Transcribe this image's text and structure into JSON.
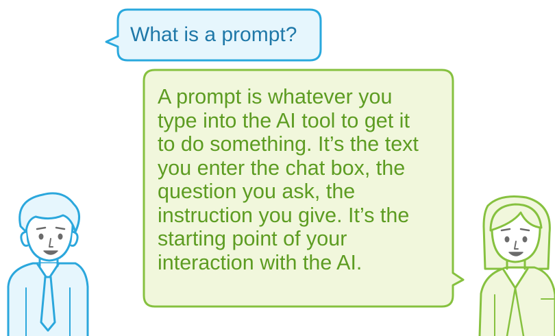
{
  "question": {
    "text": "What is a prompt?"
  },
  "answer": {
    "lines": [
      "A prompt is whatever you",
      "type into the AI tool to get it",
      "to do something. It’s the text",
      "you enter the chat box, the",
      "question you ask, the",
      "instruction you give. It’s the",
      "starting point of your",
      "interaction with the AI."
    ]
  },
  "colors": {
    "question_bubble_fill": "#e6f6fd",
    "question_bubble_stroke": "#29a8dd",
    "question_text": "#1f78a8",
    "answer_bubble_fill": "#f1f7dc",
    "answer_bubble_stroke": "#86c13f",
    "answer_text": "#5d9c22",
    "man_outline": "#2ba7dc",
    "woman_outline": "#86c13f",
    "face_detail": "#6b6b6b"
  },
  "characters": {
    "left": "man-icon",
    "right": "woman-icon"
  }
}
